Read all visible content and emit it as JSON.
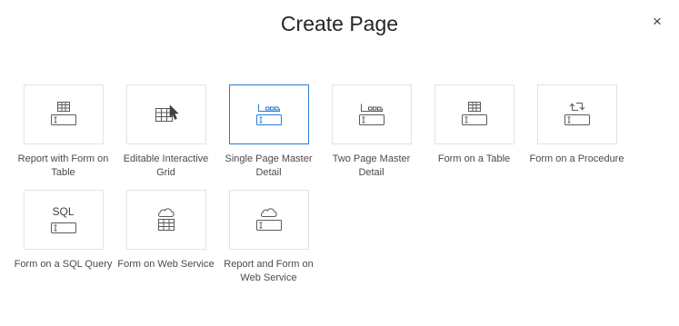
{
  "dialog": {
    "title": "Create Page",
    "close_glyph": "×"
  },
  "tiles": [
    {
      "label": "Report with Form on Table",
      "icon": "report-form-icon",
      "selected": false
    },
    {
      "label": "Editable Interactive Grid",
      "icon": "editable-grid-icon",
      "selected": false
    },
    {
      "label": "Single Page Master Detail",
      "icon": "single-page-master-detail-icon",
      "selected": true
    },
    {
      "label": "Two Page Master Detail",
      "icon": "two-page-master-detail-icon",
      "selected": false
    },
    {
      "label": "Form on a Table",
      "icon": "form-table-icon",
      "selected": false
    },
    {
      "label": "Form on a Procedure",
      "icon": "form-procedure-icon",
      "selected": false
    },
    {
      "label": "Form on a SQL Query",
      "icon": "form-sql-icon",
      "selected": false,
      "icon_text": "SQL"
    },
    {
      "label": "Form on Web Service",
      "icon": "form-web-service-icon",
      "selected": false
    },
    {
      "label": "Report and Form on Web Service",
      "icon": "report-form-web-service-icon",
      "selected": false
    }
  ],
  "colors": {
    "selected_border": "#2f7bd3",
    "selected_icon": "#2f7bd3",
    "icon": "#5a5a5a",
    "tile_border": "#e3e3e3"
  }
}
